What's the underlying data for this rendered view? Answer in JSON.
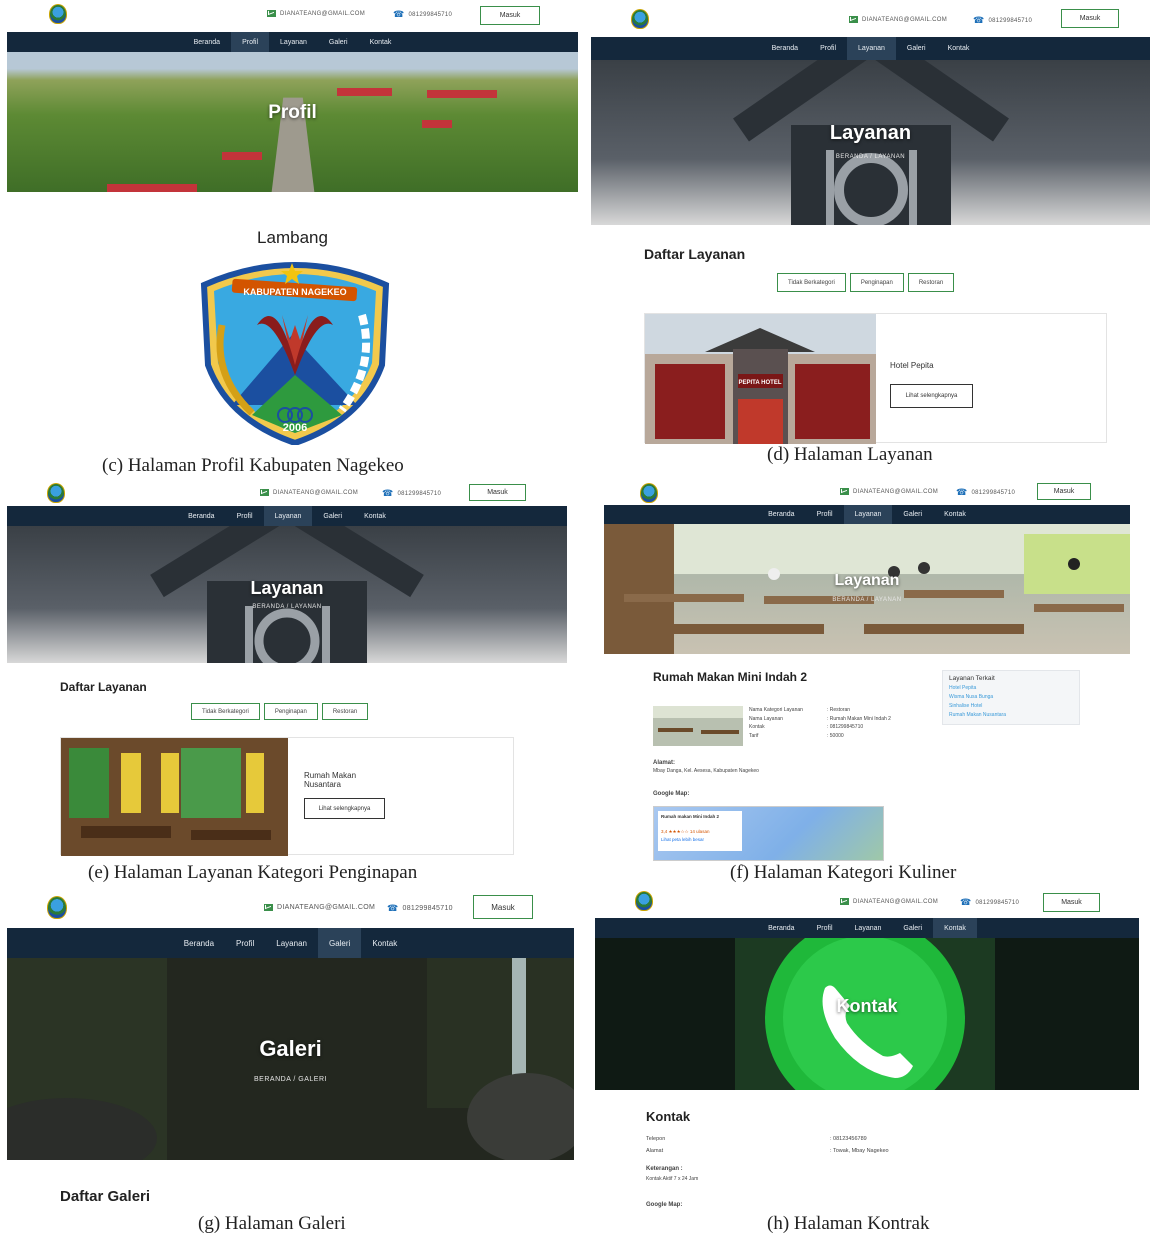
{
  "common": {
    "email": "DIANATEANG@GMAIL.COM",
    "phone": "081299845710",
    "login": "Masuk",
    "nav": [
      "Beranda",
      "Profil",
      "Layanan",
      "Galeri",
      "Kontak"
    ],
    "crumb": "BERANDA  /  LAYANAN",
    "crumb_galeri": "BERANDA  /  GALERI",
    "filters": [
      "Tidak Berkategori",
      "Penginapan",
      "Restoran"
    ],
    "detail_button": "Lihat selengkapnya"
  },
  "panel_c": {
    "hero_title": "Profil",
    "section_title": "Lambang",
    "emblem_banner": "KABUPATEN NAGEKEO",
    "emblem_year": "2006",
    "caption": "(c) Halaman Profil Kabupaten Nagekeo"
  },
  "panel_d": {
    "hero_title": "Layanan",
    "section_title": "Daftar Layanan",
    "card_name": "Hotel Pepita",
    "sign_text": "PEPITA HOTEL",
    "caption": "(d) Halaman Layanan"
  },
  "panel_e": {
    "hero_title": "Layanan",
    "section_title": "Daftar Layanan",
    "card_name": "Rumah Makan\nNusantara",
    "caption": "(e) Halaman Layanan Kategori Penginapan"
  },
  "panel_f": {
    "hero_title": "Layanan",
    "title": "Rumah Makan Mini Indah 2",
    "details": [
      {
        "k": "Nama Kategori Layanan",
        "v": ": Restoran"
      },
      {
        "k": "Nama Layanan",
        "v": ": Rumah Makan Mini Indah 2"
      },
      {
        "k": "Kontak",
        "v": ": 081299845710"
      },
      {
        "k": "Tarif",
        "v": ": 50000"
      }
    ],
    "address_label": "Alamat:",
    "address": "Mbay Danga, Kel. Aesesa, Kabupaten Nagekeo",
    "map_label": "Google Map:",
    "map_card_title": "Rumah makan Mini Indah 2",
    "map_card_rating": "3,4 ★★★☆☆  14 ulasan",
    "map_card_link": "Lihat peta lebih besar",
    "related_title": "Layanan Terkait",
    "related": [
      "Hotel Pepita",
      "Wisma Nusa Bunga",
      "Sinhalise Hotel",
      "Rumah Makan Nusantara"
    ],
    "caption": "(f) Halaman Kategori Kuliner"
  },
  "panel_g": {
    "hero_title": "Galeri",
    "section_title": "Daftar Galeri",
    "caption": "(g) Halaman Galeri"
  },
  "panel_h": {
    "hero_title": "Kontak",
    "section_title": "Kontak",
    "rows": [
      {
        "k": "Telepon",
        "v": ": 08123456789"
      },
      {
        "k": "Alamat",
        "v": ": Towak, Mbay Nagekeo"
      }
    ],
    "note_label": "Keterangan :",
    "note": "Kontak Aktif 7 x 24 Jam",
    "map_label": "Google Map:",
    "caption": "(h) Halaman Kontrak"
  }
}
